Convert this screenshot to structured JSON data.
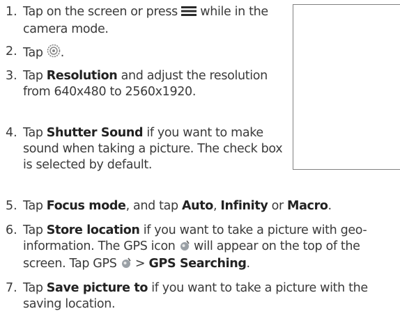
{
  "steps": [
    {
      "num": "1.",
      "a": "Tap on the screen or press",
      "b": "while in the camera mode.",
      "menu_icon": "menu-icon"
    },
    {
      "num": "2.",
      "a": "Tap",
      "b": ".",
      "settings_icon": "settings-gear-icon"
    },
    {
      "num": "3.",
      "a": "Tap",
      "bold": "Resolution",
      "b": "and adjust the resolution from 640x480 to 2560x1920."
    },
    {
      "num": "4.",
      "a": "Tap",
      "bold": "Shutter Sound",
      "b": "if you want to make sound when taking a picture. The check box is selected by default."
    },
    {
      "num": "5.",
      "a": "Tap",
      "bold1": "Focus mode",
      "b": ", and tap",
      "bold2": "Auto",
      "c": ",",
      "bold3": "Infinity",
      "d": "or",
      "bold4": "Macro",
      "e": "."
    },
    {
      "num": "6.",
      "a": "Tap",
      "bold1": "Store location",
      "b": "if you want to take a picture with geo-information. The GPS icon",
      "c": "will appear on the top of the screen. Tap GPS",
      "d": ">",
      "bold2": "GPS Searching",
      "e": ".",
      "gps_icon": "gps-icon"
    },
    {
      "num": "7.",
      "a": "Tap",
      "bold": "Save picture to",
      "b": "if you want to take a picture with the saving location."
    }
  ]
}
